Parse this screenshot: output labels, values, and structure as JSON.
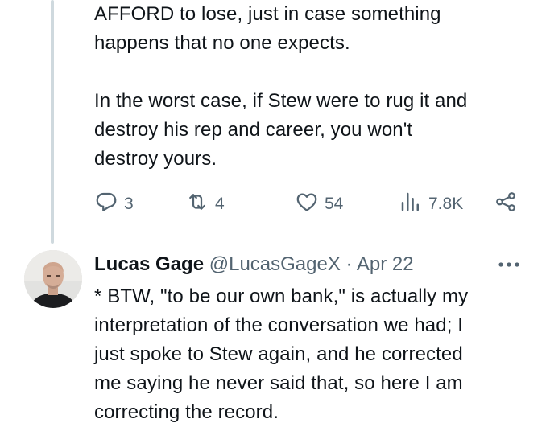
{
  "tweet_top": {
    "paragraphs": [
      "AFFORD to lose, just in case something happens that no one expects.",
      "In the worst case, if Stew were to rug it and destroy his rep and career, you won't destroy yours."
    ],
    "lines": [
      "AFFORD to lose, just in case something",
      "happens that no one expects.",
      "In the worst case, if Stew were to rug it and",
      "destroy his rep and career, you won't",
      "destroy yours."
    ],
    "actions": {
      "replies": "3",
      "retweets": "4",
      "likes": "54",
      "views": "7.8K"
    },
    "icons": [
      "reply-icon",
      "retweet-icon",
      "like-icon",
      "views-icon",
      "share-icon"
    ]
  },
  "reply_tweet": {
    "author_name": "Lucas Gage",
    "author_handle": "@LucasGageX",
    "separator": "·",
    "date": "Apr 22",
    "more_icon": "more-icon",
    "lines": [
      "* BTW, \"to be our own bank,\" is actually my",
      "interpretation of the conversation we had; I",
      "just spoke to Stew again, and he corrected",
      "me saying he never said that, so here I am",
      "correcting the record."
    ]
  },
  "colors": {
    "text": "#0f1419",
    "secondary": "#536471",
    "thread_line": "#cfd9de",
    "background": "#ffffff"
  }
}
